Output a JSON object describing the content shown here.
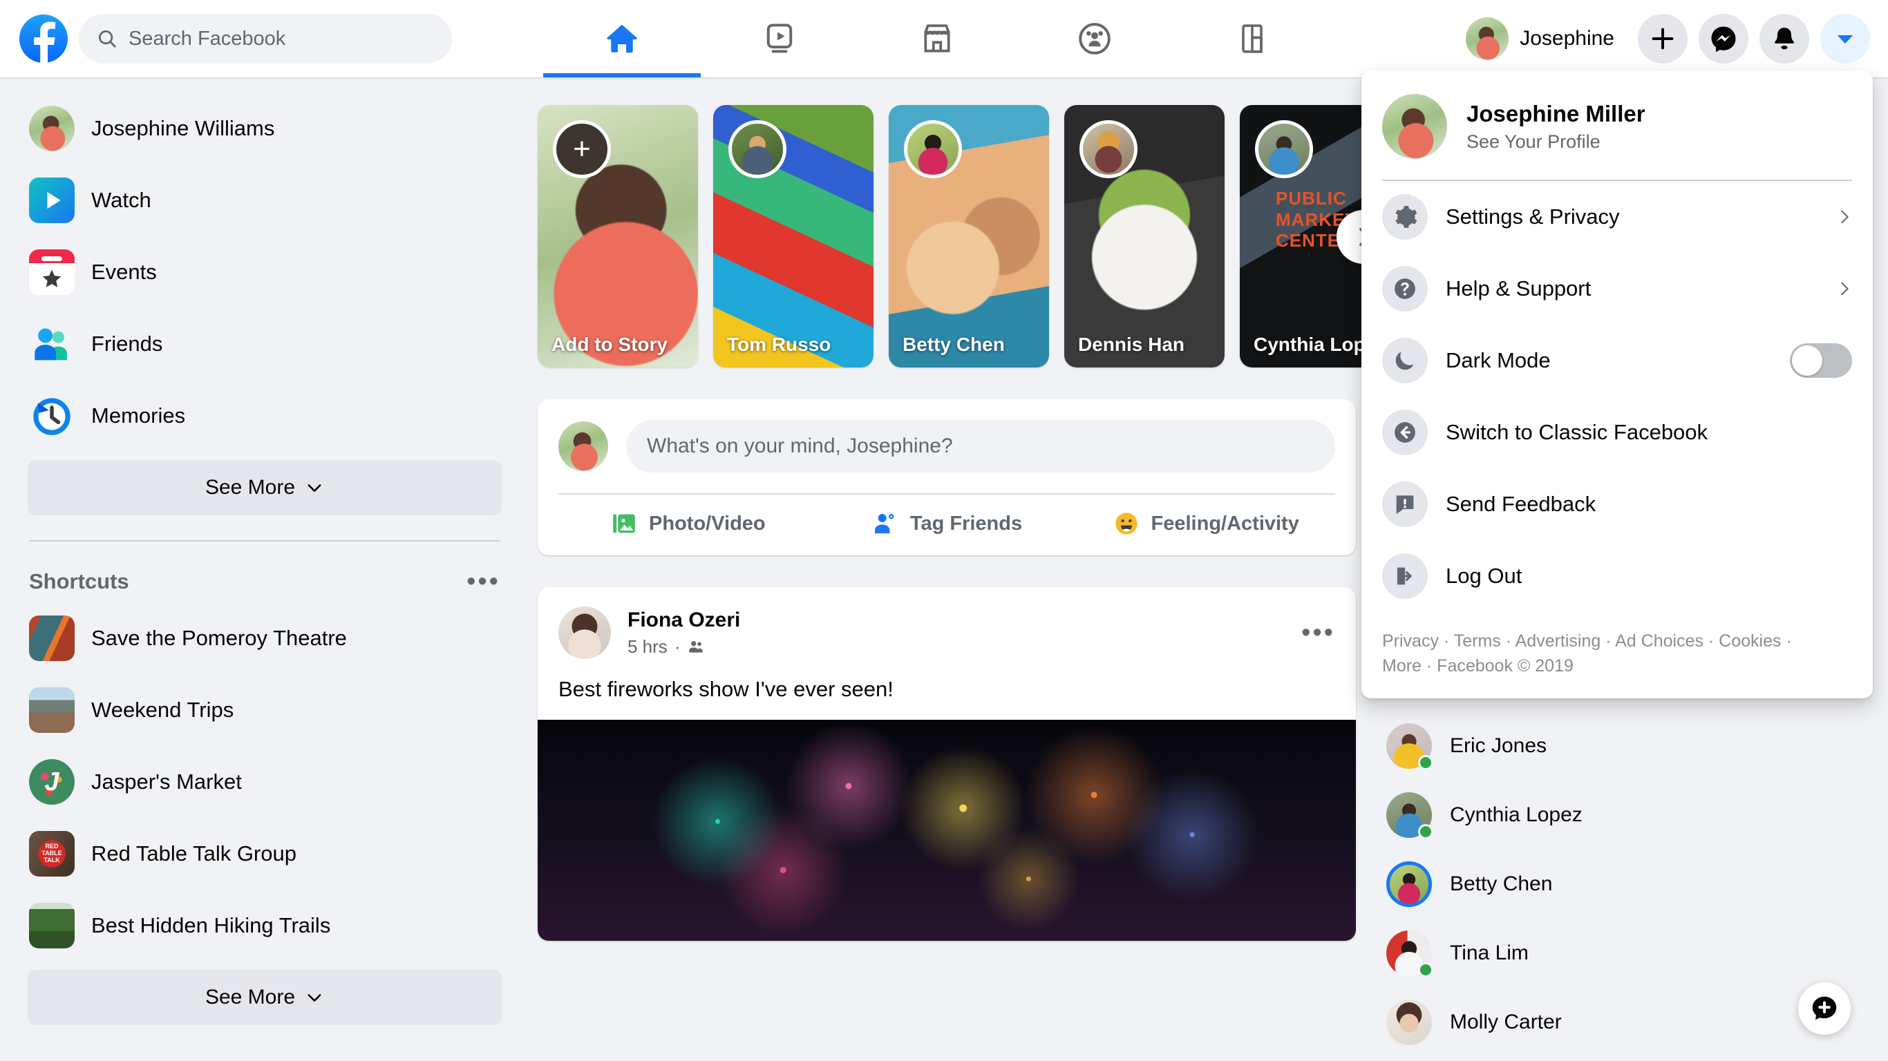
{
  "topbar": {
    "logo_icon": "facebook-logo",
    "search": {
      "placeholder": "Search Facebook",
      "value": "",
      "icon": "search-icon"
    },
    "nav_tabs": [
      {
        "name": "home",
        "icon": "home-icon",
        "active": true
      },
      {
        "name": "watch",
        "icon": "watch-video-icon",
        "active": false
      },
      {
        "name": "marketplace",
        "icon": "marketplace-store-icon",
        "active": false
      },
      {
        "name": "groups",
        "icon": "groups-icon",
        "active": false
      },
      {
        "name": "gaming",
        "icon": "gaming-icon",
        "active": false
      }
    ],
    "profile_name": "Josephine",
    "actions": [
      {
        "name": "create",
        "icon": "plus-icon"
      },
      {
        "name": "messenger",
        "icon": "messenger-icon"
      },
      {
        "name": "notifications",
        "icon": "bell-icon"
      },
      {
        "name": "account-menu",
        "icon": "chevron-down-icon",
        "active": true
      }
    ]
  },
  "sidebar": {
    "items": [
      {
        "label": "Josephine Williams",
        "icon": "user-avatar-icon"
      },
      {
        "label": "Watch",
        "icon": "watch-icon"
      },
      {
        "label": "Events",
        "icon": "events-calendar-icon"
      },
      {
        "label": "Friends",
        "icon": "friends-icon"
      },
      {
        "label": "Memories",
        "icon": "memories-clock-icon"
      }
    ],
    "see_more_label": "See More",
    "shortcuts_title": "Shortcuts",
    "shortcuts_more_icon": "ellipsis-icon",
    "shortcuts": [
      {
        "label": "Save the Pomeroy Theatre",
        "icon": "shortcut-thumbnail"
      },
      {
        "label": "Weekend Trips",
        "icon": "shortcut-thumbnail"
      },
      {
        "label": "Jasper's Market",
        "icon": "shortcut-thumbnail"
      },
      {
        "label": "Red Table Talk Group",
        "icon": "shortcut-thumbnail"
      },
      {
        "label": "Best Hidden Hiking Trails",
        "icon": "shortcut-thumbnail"
      }
    ],
    "shortcuts_see_more_label": "See More"
  },
  "stories": {
    "items": [
      {
        "label": "Add to Story",
        "type": "add",
        "icon": "plus-icon"
      },
      {
        "label": "Tom Russo",
        "type": "story"
      },
      {
        "label": "Betty Chen",
        "type": "story"
      },
      {
        "label": "Dennis Han",
        "type": "story"
      },
      {
        "label": "Cynthia Lopez",
        "type": "story"
      }
    ],
    "next_icon": "chevron-right-icon",
    "cynthia_sign_text": "PUBLIC MARKET CENTER"
  },
  "composer": {
    "placeholder": "What's on your mind, Josephine?",
    "actions": [
      {
        "label": "Photo/Video",
        "icon": "photo-video-icon",
        "color": "#45bd62"
      },
      {
        "label": "Tag Friends",
        "icon": "tag-friends-icon",
        "color": "#1877f2"
      },
      {
        "label": "Feeling/Activity",
        "icon": "feeling-activity-icon",
        "color": "#f7b928"
      }
    ]
  },
  "post": {
    "author": "Fiona Ozeri",
    "time": "5 hrs",
    "audience_icon": "friends-audience-icon",
    "menu_icon": "ellipsis-icon",
    "text": "Best fireworks show I've ever seen!"
  },
  "contacts": {
    "items": [
      {
        "name": "Eric Jones",
        "online": true,
        "story_ring": false
      },
      {
        "name": "Cynthia Lopez",
        "online": true,
        "story_ring": false
      },
      {
        "name": "Betty Chen",
        "online": false,
        "story_ring": true
      },
      {
        "name": "Tina Lim",
        "online": true,
        "story_ring": false
      },
      {
        "name": "Molly Carter",
        "online": false,
        "story_ring": false
      }
    ]
  },
  "fab": {
    "icon": "new-message-icon"
  },
  "account_menu": {
    "user_name": "Josephine Miller",
    "user_subtitle": "See Your Profile",
    "items": [
      {
        "label": "Settings & Privacy",
        "icon": "gear-icon",
        "trailing": "chevron"
      },
      {
        "label": "Help & Support",
        "icon": "question-mark-icon",
        "trailing": "chevron"
      },
      {
        "label": "Dark Mode",
        "icon": "moon-icon",
        "trailing": "toggle",
        "toggle_on": false
      },
      {
        "label": "Switch to Classic Facebook",
        "icon": "arrow-left-icon",
        "trailing": "none"
      },
      {
        "label": "Send Feedback",
        "icon": "feedback-icon",
        "trailing": "none"
      },
      {
        "label": "Log Out",
        "icon": "logout-icon",
        "trailing": "none"
      }
    ],
    "footer_line1": "Privacy · Terms · Advertising · Ad Choices · Cookies ·",
    "footer_line2": "More · Facebook © 2019"
  },
  "colors": {
    "brand": "#1877f2",
    "bg": "#f0f2f5",
    "card": "#ffffff",
    "online": "#31a24c"
  }
}
